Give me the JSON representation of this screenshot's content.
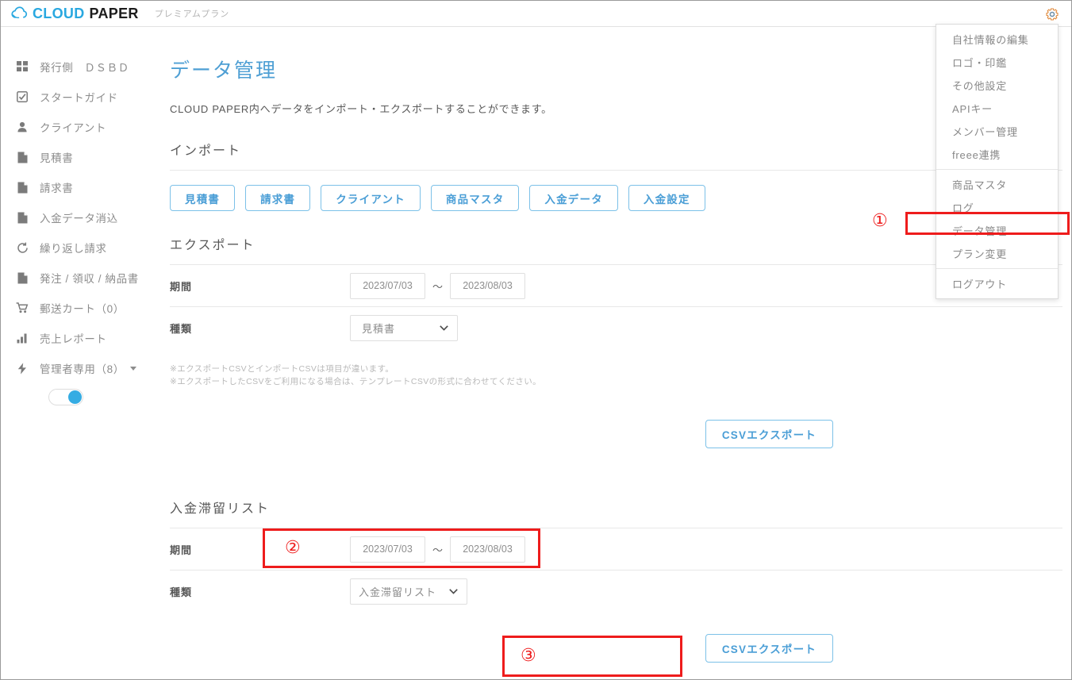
{
  "header": {
    "logo_cloud": "CLOUD",
    "logo_paper": "PAPER",
    "plan_label": "プレミアムプラン",
    "gear_icon": "gear-icon"
  },
  "sidebar": {
    "items": [
      {
        "label": "発行側　ＤＳＢＤ",
        "icon": "grid-icon"
      },
      {
        "label": "スタートガイド",
        "icon": "checkbox-icon"
      },
      {
        "label": "クライアント",
        "icon": "person-icon"
      },
      {
        "label": "見積書",
        "icon": "document-icon"
      },
      {
        "label": "請求書",
        "icon": "document-icon"
      },
      {
        "label": "入金データ消込",
        "icon": "document-icon"
      },
      {
        "label": "繰り返し請求",
        "icon": "refresh-icon"
      },
      {
        "label": "発注 / 領収 / 納品書",
        "icon": "document-icon"
      },
      {
        "label": "郵送カート（0）",
        "icon": "cart-icon"
      },
      {
        "label": "売上レポート",
        "icon": "bar-chart-icon"
      },
      {
        "label": "管理者専用（8）",
        "icon": "bolt-icon",
        "has_caret": true
      }
    ],
    "toggle_on": true
  },
  "main": {
    "page_title": "データ管理",
    "page_desc": "CLOUD PAPER内へデータをインポート・エクスポートすることができます。",
    "import": {
      "title": "インポート",
      "buttons": [
        "見積書",
        "請求書",
        "クライアント",
        "商品マスタ",
        "入金データ",
        "入金設定"
      ]
    },
    "export": {
      "title": "エクスポート",
      "period_label": "期間",
      "date_from": "2023/07/03",
      "date_to": "2023/08/03",
      "tilde": "～",
      "type_label": "種類",
      "type_value": "見積書",
      "note_line1": "※エクスポートCSVとインポートCSVは項目が違います。",
      "note_line2": "※エクスポートしたCSVをご利用になる場合は、テンプレートCSVの形式に合わせてください。",
      "export_button": "CSVエクスポート"
    },
    "delinquency": {
      "title": "入金滞留リスト",
      "period_label": "期間",
      "date_from": "2023/07/03",
      "date_to": "2023/08/03",
      "tilde": "～",
      "type_label": "種類",
      "type_value": "入金滞留リスト",
      "export_button": "CSVエクスポート"
    }
  },
  "settings_menu": {
    "groups": [
      [
        "自社情報の編集",
        "ロゴ・印鑑",
        "その他設定",
        "APIキー",
        "メンバー管理",
        "freee連携"
      ],
      [
        "商品マスタ",
        "ログ",
        "データ管理",
        "プラン変更"
      ],
      [
        "ログアウト"
      ]
    ],
    "items": [
      "自社情報の編集",
      "ロゴ・印鑑",
      "その他設定",
      "APIキー",
      "メンバー管理",
      "freee連携",
      "商品マスタ",
      "ログ",
      "データ管理",
      "プラン変更",
      "ログアウト"
    ]
  },
  "annotations": {
    "marker1": "①",
    "marker2": "②",
    "marker3": "③"
  },
  "colors": {
    "brand_blue": "#29a8e0",
    "title_blue": "#4e9fd4",
    "button_blue": "#4a9ed6",
    "annotation_red": "#ee1c1c",
    "text_gray": "#8d8d8d"
  }
}
